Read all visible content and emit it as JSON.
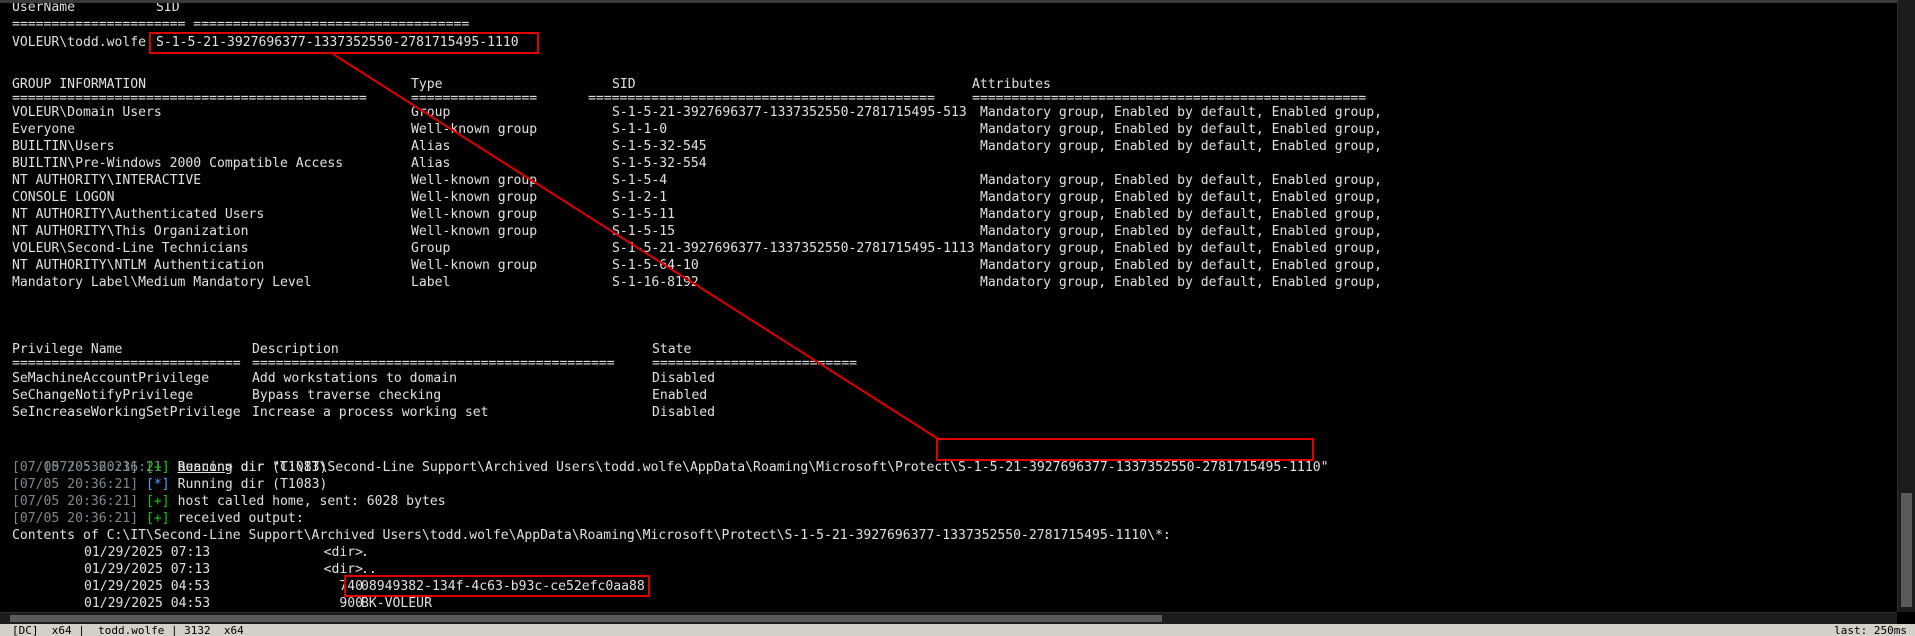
{
  "whoami": {
    "user_header": "UserName",
    "sid_header": "SID",
    "separator": "====================== ===================================",
    "user": "VOLEUR\\todd.wolfe",
    "sid": "S-1-5-21-3927696377-1337352550-2781715495-1110"
  },
  "groups": {
    "headers": [
      "GROUP INFORMATION",
      "Type",
      "SID",
      "Attributes"
    ],
    "separators": [
      "=============================================",
      "================",
      "============================================",
      "=================================================="
    ],
    "rows": [
      [
        "VOLEUR\\Domain Users",
        "Group",
        "S-1-5-21-3927696377-1337352550-2781715495-513",
        "Mandatory group, Enabled by default, Enabled group,"
      ],
      [
        "Everyone",
        "Well-known group",
        "S-1-1-0",
        "Mandatory group, Enabled by default, Enabled group,"
      ],
      [
        "BUILTIN\\Users",
        "Alias",
        "S-1-5-32-545",
        "Mandatory group, Enabled by default, Enabled group,"
      ],
      [
        "BUILTIN\\Pre-Windows 2000 Compatible Access",
        "Alias",
        "S-1-5-32-554",
        ""
      ],
      [
        "NT AUTHORITY\\INTERACTIVE",
        "Well-known group",
        "S-1-5-4",
        "Mandatory group, Enabled by default, Enabled group,"
      ],
      [
        "CONSOLE LOGON",
        "Well-known group",
        "S-1-2-1",
        "Mandatory group, Enabled by default, Enabled group,"
      ],
      [
        "NT AUTHORITY\\Authenticated Users",
        "Well-known group",
        "S-1-5-11",
        "Mandatory group, Enabled by default, Enabled group,"
      ],
      [
        "NT AUTHORITY\\This Organization",
        "Well-known group",
        "S-1-5-15",
        "Mandatory group, Enabled by default, Enabled group,"
      ],
      [
        "VOLEUR\\Second-Line Technicians",
        "Group",
        "S-1-5-21-3927696377-1337352550-2781715495-1113",
        "Mandatory group, Enabled by default, Enabled group,"
      ],
      [
        "NT AUTHORITY\\NTLM Authentication",
        "Well-known group",
        "S-1-5-64-10",
        "Mandatory group, Enabled by default, Enabled group,"
      ],
      [
        "Mandatory Label\\Medium Mandatory Level",
        "Label",
        "S-1-16-8192",
        "Mandatory group, Enabled by default, Enabled group,"
      ]
    ]
  },
  "privileges": {
    "headers": [
      "Privilege Name",
      "Description",
      "State"
    ],
    "separators": [
      "=============================",
      "==============================================",
      "=========================="
    ],
    "rows": [
      [
        "SeMachineAccountPrivilege",
        "Add workstations to domain",
        "Disabled"
      ],
      [
        "SeChangeNotifyPrivilege",
        "Bypass traverse checking",
        "Enabled"
      ],
      [
        "SeIncreaseWorkingSetPrivilege",
        "Increase a process working set",
        "Disabled"
      ]
    ]
  },
  "beacon_log": {
    "timestamp": "[07/05 20:36:21]",
    "prompt": "beacon",
    "command_prefix": "> dir \"C:\\IT\\Second-Line Support\\Archived Users\\todd.wolfe\\AppData\\Roaming\\Microsoft\\Protect\\",
    "command_sid": "S-1-5-21-3927696377-1337352550-2781715495-1110",
    "command_suffix": "\"",
    "lines": [
      {
        "marker": "[+]",
        "kind": "plus",
        "text": " Running dir (T1083)"
      },
      {
        "marker": "[*]",
        "kind": "star",
        "text": " Running dir (T1083)"
      },
      {
        "marker": "[+]",
        "kind": "plus",
        "text": " host called home, sent: 6028 bytes"
      },
      {
        "marker": "[+]",
        "kind": "plus",
        "text": " received output:"
      }
    ]
  },
  "dir_listing": {
    "contents_line": "Contents of C:\\IT\\Second-Line Support\\Archived Users\\todd.wolfe\\AppData\\Roaming\\Microsoft\\Protect\\S-1-5-21-3927696377-1337352550-2781715495-1110\\*:",
    "entries": [
      {
        "date": "01/29/2025 07:13",
        "size": "<dir>",
        "name": "."
      },
      {
        "date": "01/29/2025 07:13",
        "size": "<dir>",
        "name": ".."
      },
      {
        "date": "01/29/2025 04:53",
        "size": "740",
        "name": "08949382-134f-4c63-b93c-ce52efc0aa88"
      },
      {
        "date": "01/29/2025 04:53",
        "size": "900",
        "name": "BK-VOLEUR"
      }
    ]
  },
  "statusbar": {
    "left": "[DC]  x64 |  todd.wolfe | 3132  x64",
    "right": "last: 250ms"
  },
  "colors": {
    "background": "#000000",
    "text": "#e0e0e0",
    "highlight_box": "#e00000",
    "plus_marker": "#00d000",
    "star_marker": "#4aa3ff",
    "timestamp": "#7f8890"
  }
}
